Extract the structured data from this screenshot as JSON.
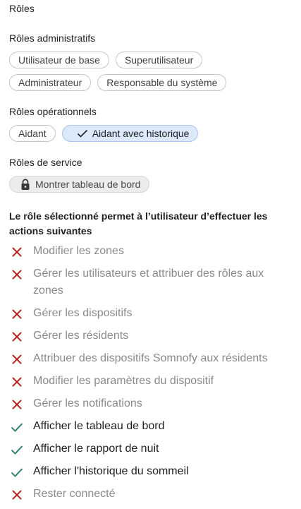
{
  "page_title": "Rôles",
  "sections": [
    {
      "title": "Rôles administratifs"
    },
    {
      "title": "Rôles opérationnels"
    },
    {
      "title": "Rôles de service"
    }
  ],
  "admin_roles": [
    "Utilisateur de base",
    "Superutilisateur",
    "Administrateur",
    "Responsable du système"
  ],
  "operational_roles": [
    "Aidant",
    "Aidant avec historique"
  ],
  "service_roles": [
    "Montrer tableau de bord"
  ],
  "permissions_title": "Le rôle sélectionné permet à l’utilisateur d’effectuer les actions suivantes",
  "permissions": [
    {
      "label": "Modifier les zones",
      "allowed": false
    },
    {
      "label": "Gérer les utilisateurs et attribuer des rôles aux zones",
      "allowed": false
    },
    {
      "label": "Gérer les dispositifs",
      "allowed": false
    },
    {
      "label": "Gérer les résidents",
      "allowed": false
    },
    {
      "label": "Attribuer des dispositifs Somnofy aux résidents",
      "allowed": false
    },
    {
      "label": "Modifier les paramètres du dispositif",
      "allowed": false
    },
    {
      "label": "Gérer les notifications",
      "allowed": false
    },
    {
      "label": "Afficher le tableau de bord",
      "allowed": true
    },
    {
      "label": "Afficher le rapport de nuit",
      "allowed": true
    },
    {
      "label": "Afficher l'historique du sommeil",
      "allowed": true
    },
    {
      "label": "Rester connecté",
      "allowed": false
    }
  ],
  "colors": {
    "allowed_icon": "#2e7d6b",
    "denied_icon": "#b3261e",
    "selected_chip": "#dbe9fb"
  }
}
